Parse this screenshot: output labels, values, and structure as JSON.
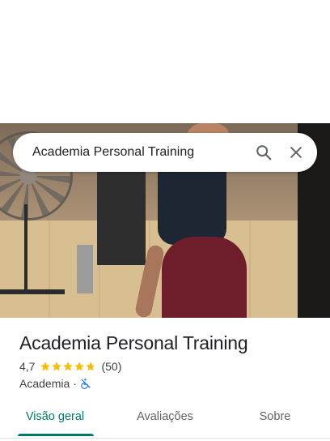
{
  "search": {
    "query": "Academia Personal Training"
  },
  "place": {
    "name": "Academia Personal Training",
    "rating": "4,7",
    "rating_value": 4.7,
    "review_count": "(50)",
    "category": "Academia",
    "separator": "·",
    "attribute_icon": "no-wheelchair-icon"
  },
  "tabs": [
    {
      "label": "Visão geral",
      "active": true
    },
    {
      "label": "Avaliações",
      "active": false
    },
    {
      "label": "Sobre",
      "active": false
    }
  ],
  "colors": {
    "accent": "#00796b",
    "star": "#fbbc04",
    "accessibility_icon": "#1a73e8"
  }
}
